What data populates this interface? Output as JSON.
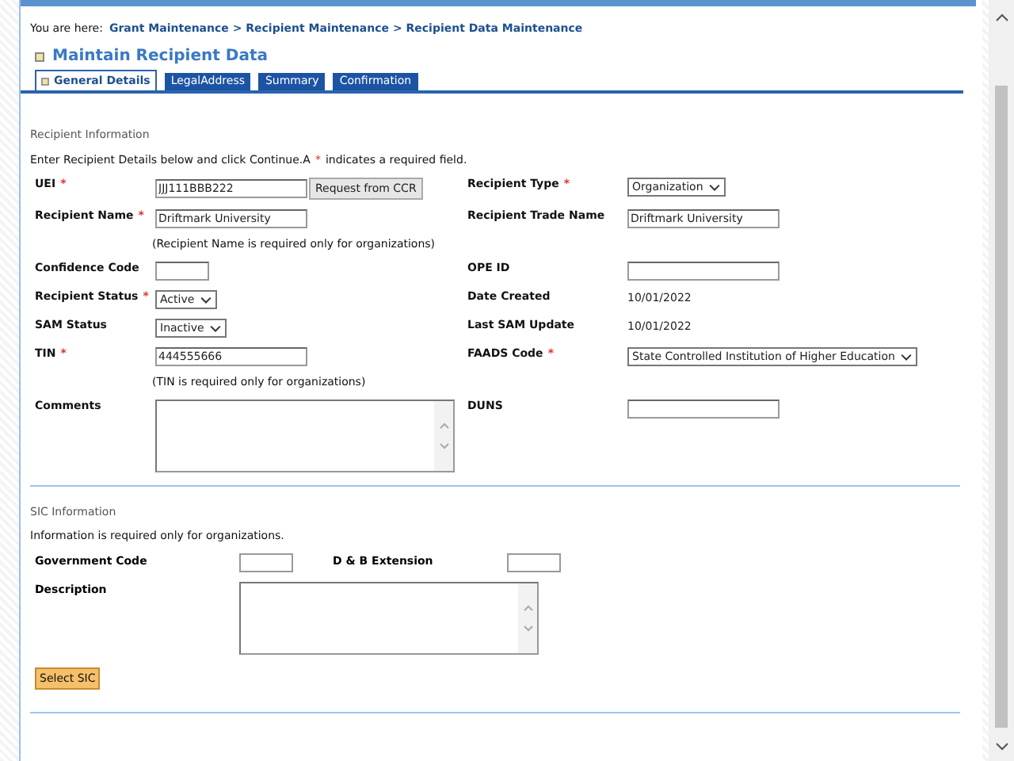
{
  "breadcrumb": {
    "prefix": "You are here:",
    "path": "Grant Maintenance > Recipient Maintenance > Recipient Data Maintenance"
  },
  "page_title": "Maintain Recipient Data",
  "tabs": [
    {
      "label": "General Details",
      "selected": true
    },
    {
      "label": "LegalAddress",
      "selected": false
    },
    {
      "label": "Summary",
      "selected": false
    },
    {
      "label": "Confirmation",
      "selected": false
    }
  ],
  "required_mark": "*",
  "recipient_section": {
    "heading": "Recipient Information",
    "instructions_start": "Enter Recipient Details below and click Continue.A",
    "instructions_end": "indicates a required field.",
    "rows": [
      {
        "kind": "fields",
        "left": {
          "label": "UEI",
          "required": true,
          "kind": "text",
          "value": "JJJ111BBB222",
          "button": "Request from CCR"
        },
        "right": {
          "label": "Recipient Type",
          "required": true,
          "kind": "select",
          "value": "Organization"
        }
      },
      {
        "kind": "fields",
        "left": {
          "label": "Recipient Name",
          "required": true,
          "kind": "text",
          "value": "Driftmark University"
        },
        "right": {
          "label": "Recipient Trade Name",
          "required": false,
          "kind": "text",
          "value": "Driftmark University"
        }
      },
      {
        "kind": "note",
        "text": "(Recipient Name is required only for organizations)"
      },
      {
        "kind": "fields",
        "left": {
          "label": "Confidence Code",
          "required": false,
          "kind": "short_text"
        },
        "right": {
          "label": "OPE ID",
          "required": false,
          "kind": "text"
        }
      },
      {
        "kind": "fields",
        "left": {
          "label": "Recipient Status",
          "required": true,
          "kind": "select",
          "value": "Active"
        },
        "right": {
          "label": "Date Created",
          "required": false,
          "kind": "static",
          "value": "10/01/2022"
        }
      },
      {
        "kind": "fields",
        "left": {
          "label": "SAM Status",
          "required": false,
          "kind": "select",
          "value": "Inactive"
        },
        "right": {
          "label": "Last SAM Update",
          "required": false,
          "kind": "static",
          "value": "10/01/2022"
        }
      },
      {
        "kind": "fields",
        "left": {
          "label": "TIN",
          "required": true,
          "kind": "text",
          "value": "444555666"
        },
        "right": {
          "label": "FAADS Code",
          "required": true,
          "kind": "select",
          "value": "State Controlled Institution of Higher Education"
        }
      },
      {
        "kind": "note",
        "text": "(TIN is required only for organizations)"
      },
      {
        "kind": "fields",
        "left": {
          "label": "Comments",
          "required": false,
          "kind": "textarea"
        },
        "right": {
          "label": "DUNS",
          "required": false,
          "kind": "text"
        }
      }
    ]
  },
  "sic_section": {
    "heading": "SIC Information",
    "info": "Information is required only for organizations.",
    "government_code_label": "Government Code",
    "dnb_extension_label": "D & B Extension",
    "description_label": "Description",
    "button": "Select SIC"
  }
}
